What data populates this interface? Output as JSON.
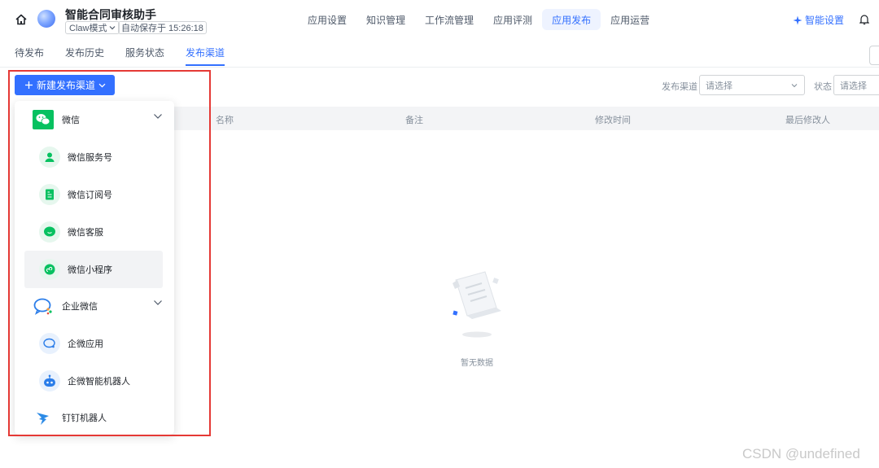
{
  "header": {
    "app_title": "智能合同审核助手",
    "mode": "Claw模式",
    "autosave": "自动保存于 15:26:18",
    "nav": [
      "应用设置",
      "知识管理",
      "工作流管理",
      "应用评测",
      "应用发布",
      "应用运营"
    ],
    "active_nav": "应用发布",
    "smart_setting": "智能设置"
  },
  "subtabs": {
    "items": [
      "待发布",
      "发布历史",
      "服务状态",
      "发布渠道"
    ],
    "active": "发布渠道"
  },
  "toolbar": {
    "new_channel_button": "新建发布渠道",
    "filter_channel_label": "发布渠道",
    "filter_channel_placeholder": "请选择",
    "filter_status_label": "状态",
    "filter_status_placeholder": "请选择"
  },
  "table": {
    "columns": [
      "名称",
      "备注",
      "修改时间",
      "最后修改人"
    ]
  },
  "empty_state": {
    "text": "暂无数据"
  },
  "dropdown": {
    "groups": [
      {
        "label": "微信",
        "icon": "wechat-icon",
        "expanded": true
      },
      {
        "label": "企业微信",
        "icon": "wecom-icon",
        "expanded": true
      },
      {
        "label": "钉钉机器人",
        "icon": "dingtalk-icon"
      }
    ],
    "wechat_items": [
      "微信服务号",
      "微信订阅号",
      "微信客服",
      "微信小程序"
    ],
    "wecom_items": [
      "企微应用",
      "企微智能机器人"
    ],
    "hovered_item": "微信小程序"
  },
  "watermark": "CSDN @undefined",
  "colors": {
    "primary": "#3370ff",
    "wechat_green": "#07c160",
    "highlight_red": "#e53935"
  }
}
